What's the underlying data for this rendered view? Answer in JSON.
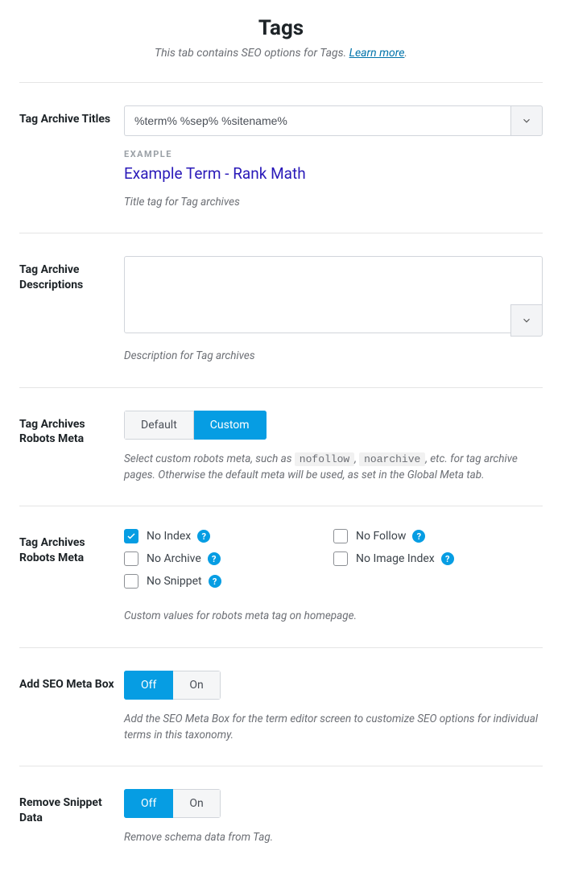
{
  "header": {
    "title": "Tags",
    "subtitle_pre": "This tab contains SEO options for Tags. ",
    "learn_more": "Learn more",
    "subtitle_post": "."
  },
  "titles": {
    "label": "Tag Archive Titles",
    "value": "%term% %sep% %sitename%",
    "example_label": "EXAMPLE",
    "example_text": "Example Term - Rank Math",
    "help": "Title tag for Tag archives"
  },
  "descriptions": {
    "label": "Tag Archive Descriptions",
    "value": "",
    "help": "Description for Tag archives"
  },
  "robots_type": {
    "label": "Tag Archives Robots Meta",
    "default": "Default",
    "custom": "Custom",
    "help_pre": "Select custom robots meta, such as ",
    "code1": "nofollow",
    "sep": ", ",
    "code2": "noarchive",
    "help_post": ", etc. for tag archive pages. Otherwise the default meta will be used, as set in the Global Meta tab."
  },
  "robots_checks": {
    "label": "Tag Archives Robots Meta",
    "noindex": "No Index",
    "nofollow": "No Follow",
    "noarchive": "No Archive",
    "noimageindex": "No Image Index",
    "nosnippet": "No Snippet",
    "help": "Custom values for robots meta tag on homepage."
  },
  "metabox": {
    "label": "Add SEO Meta Box",
    "off": "Off",
    "on": "On",
    "help": "Add the SEO Meta Box for the term editor screen to customize SEO options for individual terms in this taxonomy."
  },
  "snippet": {
    "label": "Remove Snippet Data",
    "off": "Off",
    "on": "On",
    "help": "Remove schema data from Tag."
  }
}
